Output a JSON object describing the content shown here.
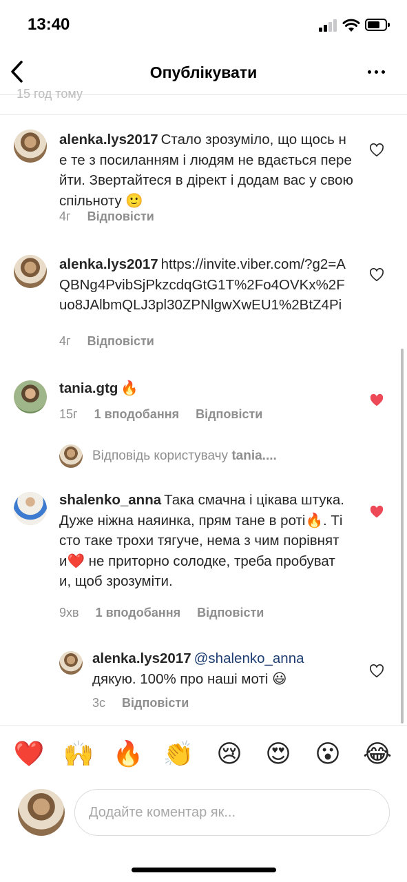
{
  "status_bar": {
    "time": "13:40"
  },
  "header": {
    "title": "Опублікувати"
  },
  "cut_off_text": "15 год тому",
  "comments": [
    {
      "username": "alenka.lys2017",
      "text": "Стало зрозуміло, що щось не те з посиланням і людям не вдається перейти. Звертайтеся в дірект і додам вас у свою спільноту 🙂",
      "time": "4г",
      "reply": "Відповісти",
      "liked": false
    },
    {
      "username": "alenka.lys2017",
      "text": "https://invite.viber.com/?g2=AQBNg4PvibSjPkzcdqGtG1T%2Fo4OVKx%2Fuo8JAlbmQLJ3pl30ZPNlgwXwEU1%2BtZ4Pi",
      "time": "4г",
      "reply": "Відповісти",
      "liked": false
    },
    {
      "username": "tania.gtg",
      "text": "🔥",
      "time": "15г",
      "likes": "1 вподобання",
      "reply": "Відповісти",
      "liked": true
    },
    {
      "username": "shalenko_anna",
      "text": "Така смачна і цікава штука. Дуже ніжна наяинка, прям тане в роті🔥. Тісто таке трохи тягуче, нема з чим порівняти❤️ не приторно солодке, треба пробувати, щоб зрозуміти.",
      "time": "9хв",
      "likes": "1 вподобання",
      "reply": "Відповісти",
      "liked": true
    }
  ],
  "view_replies": {
    "prefix": "Відповідь користувачу",
    "user": "tania...."
  },
  "reply_comment": {
    "username": "alenka.lys2017",
    "mention": "@shalenko_anna",
    "text": "дякую. 100% про наші моті 😃",
    "time": "3с",
    "reply": "Відповісти",
    "liked": false
  },
  "emoji_bar": [
    "❤️",
    "🙌",
    "🔥",
    "👏",
    "😢",
    "😍",
    "😮",
    "😂"
  ],
  "composer": {
    "placeholder": "Додайте коментар як..."
  },
  "colors": {
    "heart_liked": "#ed4956",
    "meta_gray": "#8e8e8e",
    "mention_blue": "#1e3d73"
  }
}
